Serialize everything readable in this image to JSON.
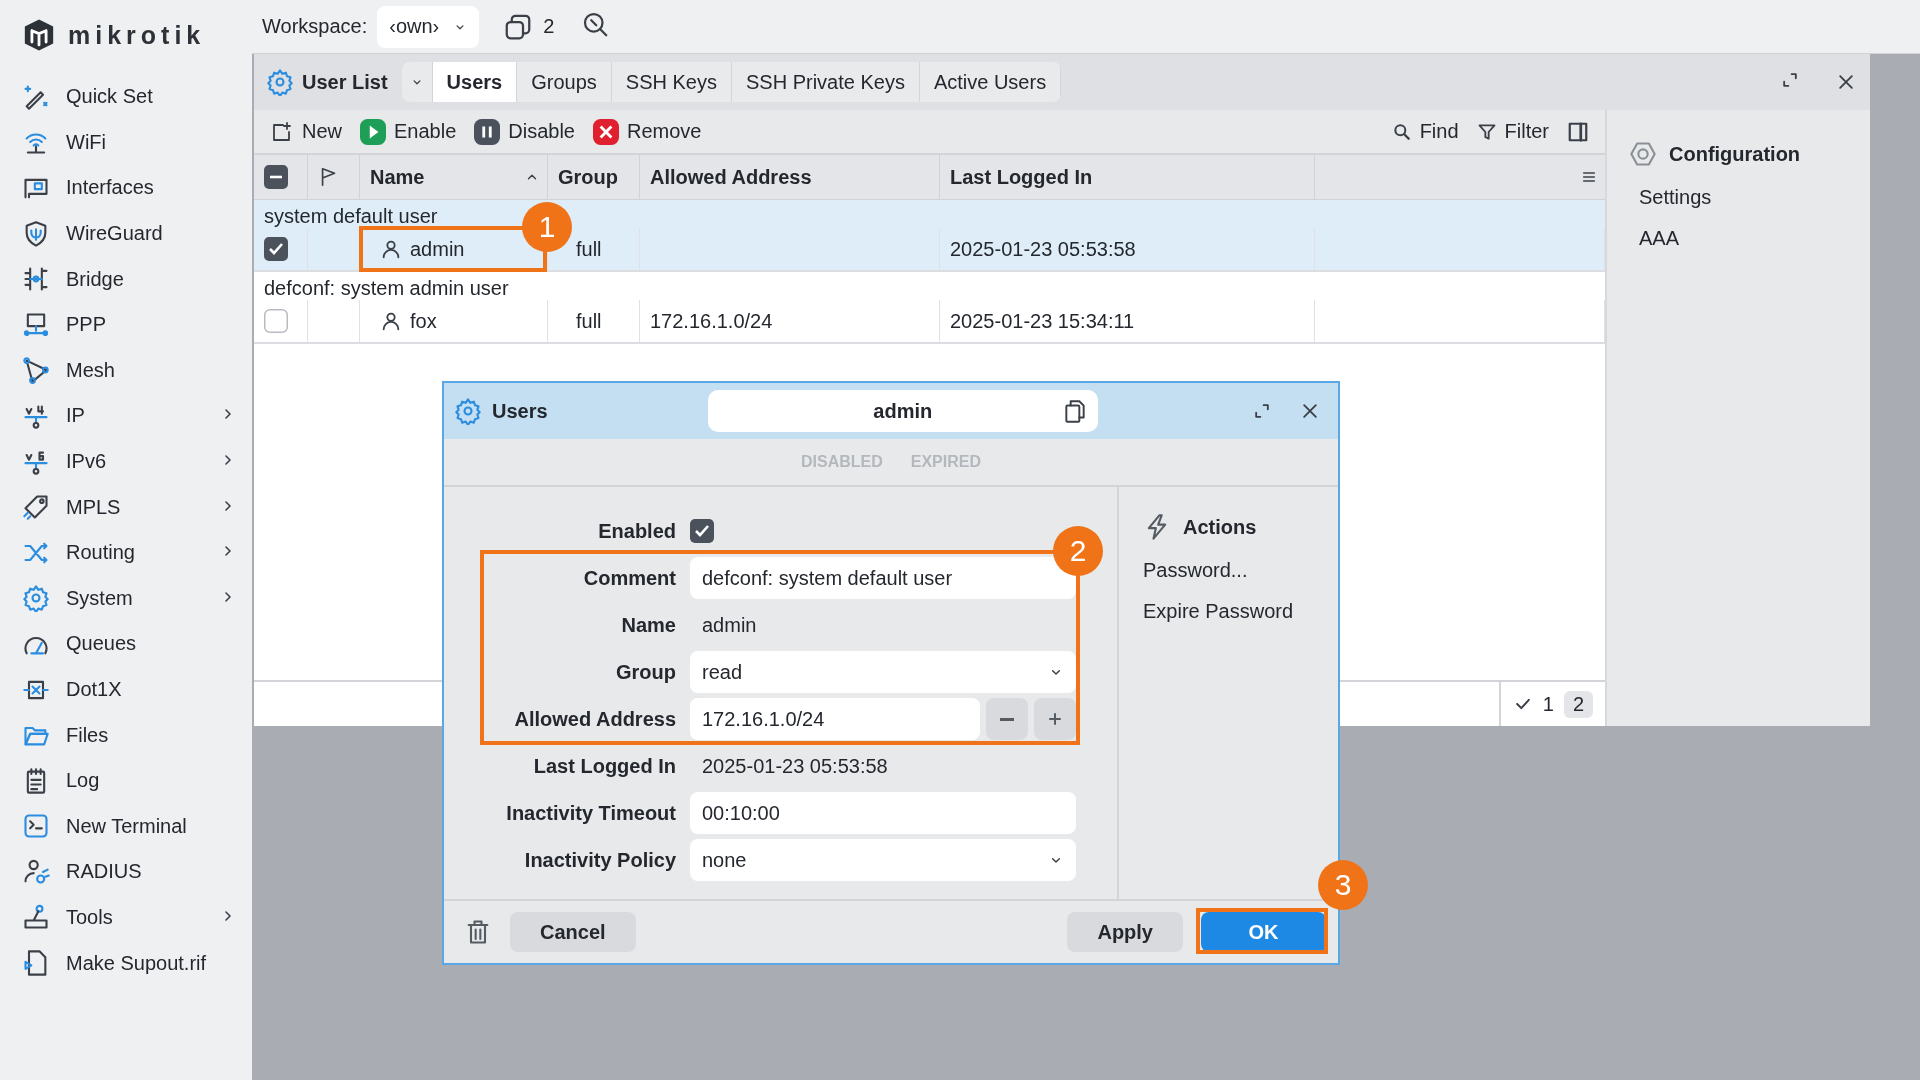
{
  "sidebar": {
    "logo": "mikrotik",
    "items": [
      {
        "label": "Quick Set",
        "submenu": false
      },
      {
        "label": "WiFi",
        "submenu": false
      },
      {
        "label": "Interfaces",
        "submenu": false
      },
      {
        "label": "WireGuard",
        "submenu": false
      },
      {
        "label": "Bridge",
        "submenu": false
      },
      {
        "label": "PPP",
        "submenu": false
      },
      {
        "label": "Mesh",
        "submenu": false
      },
      {
        "label": "IP",
        "submenu": true
      },
      {
        "label": "IPv6",
        "submenu": true
      },
      {
        "label": "MPLS",
        "submenu": true
      },
      {
        "label": "Routing",
        "submenu": true
      },
      {
        "label": "System",
        "submenu": true
      },
      {
        "label": "Queues",
        "submenu": false
      },
      {
        "label": "Dot1X",
        "submenu": false
      },
      {
        "label": "Files",
        "submenu": false
      },
      {
        "label": "Log",
        "submenu": false
      },
      {
        "label": "New Terminal",
        "submenu": false
      },
      {
        "label": "RADIUS",
        "submenu": false
      },
      {
        "label": "Tools",
        "submenu": true
      },
      {
        "label": "Make Supout.rif",
        "submenu": false
      }
    ]
  },
  "topbar": {
    "workspace_label": "Workspace:",
    "workspace_value": "‹own›",
    "window_count": "2"
  },
  "window": {
    "title": "User List",
    "tabs": [
      {
        "label": "Users",
        "selected": true
      },
      {
        "label": "Groups",
        "selected": false
      },
      {
        "label": "SSH Keys",
        "selected": false
      },
      {
        "label": "SSH Private Keys",
        "selected": false
      },
      {
        "label": "Active Users",
        "selected": false
      }
    ],
    "toolbar": [
      {
        "label": "New"
      },
      {
        "label": "Enable"
      },
      {
        "label": "Disable"
      },
      {
        "label": "Remove"
      }
    ],
    "tools": [
      {
        "label": "Find"
      },
      {
        "label": "Filter"
      }
    ],
    "table": {
      "select_all_indeterminate": true,
      "columns": [
        "Name",
        "Group",
        "Allowed Address",
        "Last Logged In"
      ],
      "rows": [
        {
          "comment": "system default user",
          "checked": true,
          "selected": true,
          "name": "admin",
          "group": "full",
          "last_logged_in": "2025-01-23 05:53:58"
        },
        {
          "comment": "defconf: system admin user",
          "checked": false,
          "selected": false,
          "name": "fox",
          "group": "full",
          "allowed_address": "172.16.1.0/24",
          "last_logged_in": "2025-01-23 15:34:11"
        }
      ]
    },
    "side_panel": {
      "title": "Configuration",
      "items": [
        "Settings",
        "AAA"
      ]
    },
    "status": {
      "checked_count": "1",
      "total_count": "2"
    }
  },
  "dialog": {
    "title": "Users",
    "name": "admin",
    "flags": [
      "DISABLED",
      "EXPIRED"
    ],
    "fields": [
      {
        "kind": "checkbox",
        "label": "Enabled",
        "checked": true
      },
      {
        "kind": "input",
        "label": "Comment",
        "value": "defconf: system default user"
      },
      {
        "kind": "text",
        "label": "Name",
        "value": "admin"
      },
      {
        "kind": "select",
        "label": "Group",
        "value": "read"
      },
      {
        "kind": "address",
        "label": "Allowed Address",
        "value": "172.16.1.0/24"
      },
      {
        "kind": "text",
        "label": "Last Logged In",
        "value": "2025-01-23 05:53:58"
      },
      {
        "kind": "input",
        "label": "Inactivity Timeout",
        "value": "00:10:00"
      },
      {
        "kind": "select",
        "label": "Inactivity Policy",
        "value": "none"
      }
    ],
    "actions_title": "Actions",
    "actions": [
      "Password...",
      "Expire Password"
    ],
    "buttons": {
      "cancel": "Cancel",
      "apply": "Apply",
      "ok": "OK"
    }
  },
  "annotations": [
    {
      "number": "1"
    },
    {
      "number": "2"
    },
    {
      "number": "3"
    }
  ]
}
